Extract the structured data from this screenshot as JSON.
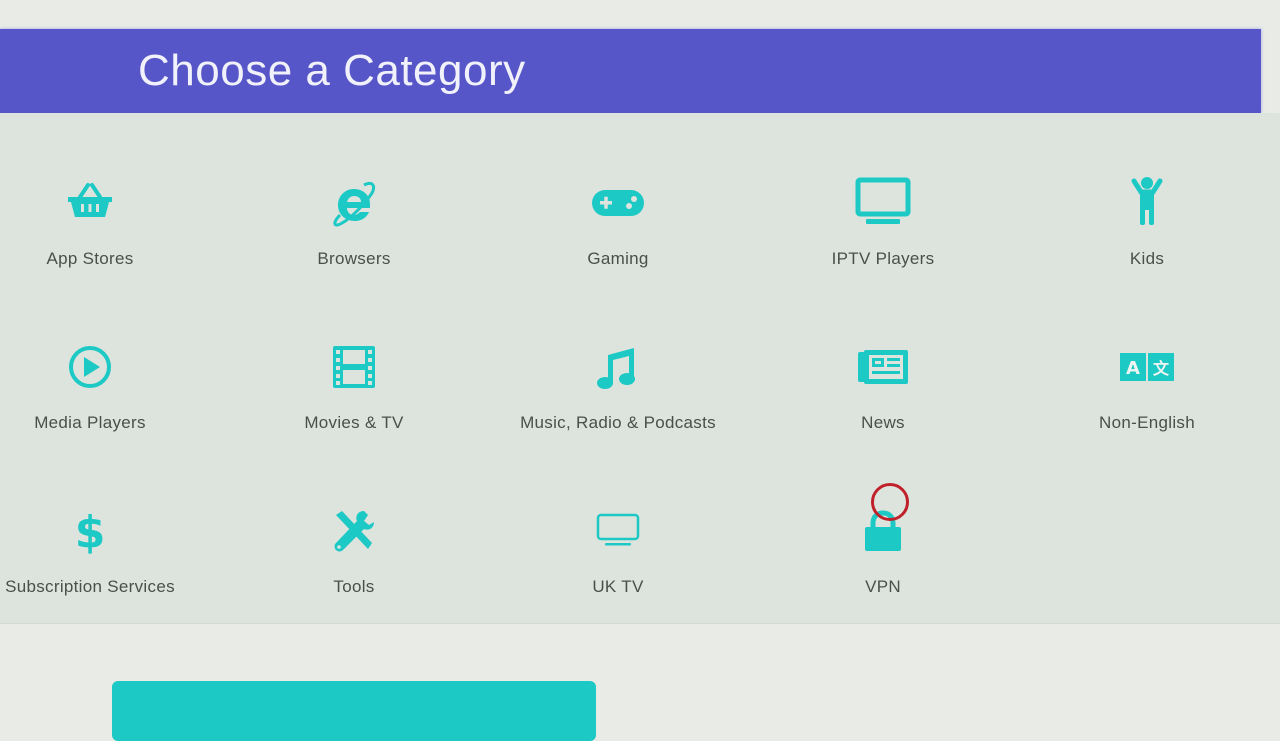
{
  "header": {
    "title": "Choose a Category"
  },
  "colors": {
    "header_bg": "#5656c8",
    "accent": "#1dc9c4",
    "panel_bg": "#dde3dd",
    "label_text": "#4a4f4c",
    "cursor_ring": "#c0202a"
  },
  "categories": [
    {
      "label": "App Stores",
      "icon": "basket-icon"
    },
    {
      "label": "Browsers",
      "icon": "internet-explorer-icon"
    },
    {
      "label": "Gaming",
      "icon": "gamepad-icon"
    },
    {
      "label": "IPTV Players",
      "icon": "monitor-icon"
    },
    {
      "label": "Kids",
      "icon": "child-icon"
    },
    {
      "label": "Media Players",
      "icon": "play-circle-icon"
    },
    {
      "label": "Movies & TV",
      "icon": "film-icon"
    },
    {
      "label": "Music, Radio & Podcasts",
      "icon": "music-note-icon"
    },
    {
      "label": "News",
      "icon": "newspaper-icon"
    },
    {
      "label": "Non-English",
      "icon": "translate-icon"
    },
    {
      "label": "Subscription Services",
      "icon": "dollar-icon"
    },
    {
      "label": "Tools",
      "icon": "tools-icon"
    },
    {
      "label": "UK TV",
      "icon": "tv-outline-icon"
    },
    {
      "label": "VPN",
      "icon": "lock-icon"
    }
  ],
  "footer": {
    "button_label": ""
  }
}
